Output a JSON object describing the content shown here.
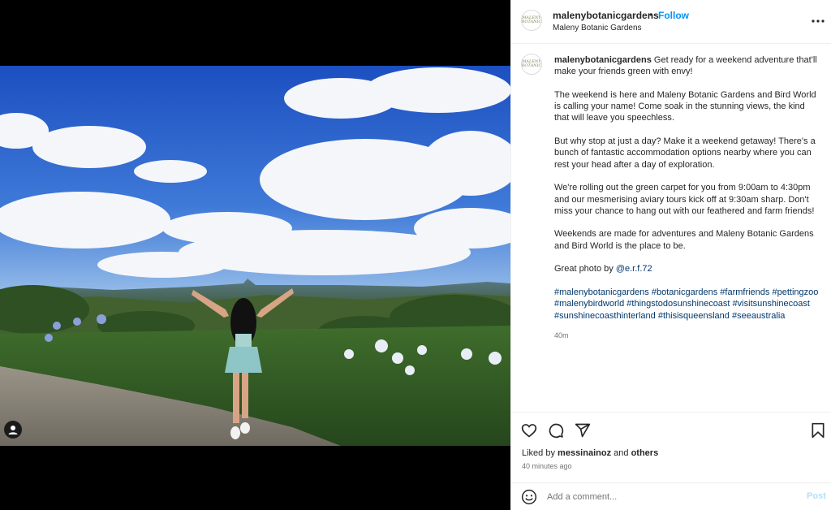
{
  "post": {
    "username": "malenybotanicgardens",
    "separator": "•",
    "follow_label": "Follow",
    "location": "Maleny Botanic Gardens",
    "avatar_text": "MALENY BOTANIC"
  },
  "caption": {
    "username": "malenybotanicgardens",
    "intro": "Get ready for a weekend adventure that'll make your friends green with envy!",
    "p1": "The weekend is here and Maleny Botanic Gardens and Bird World is calling your name! Come soak in the stunning views, the kind that will leave you speechless.",
    "p2": "But why stop at just a day? Make it a weekend getaway! There's a bunch of fantastic accommodation options nearby where you can rest your head after a day of exploration.",
    "p3": "We're rolling out the green carpet for you from 9:00am to 4:30pm and our mesmerising aviary tours kick off at 9:30am sharp. Don't miss your chance to hang out with our feathered and farm friends!",
    "p4": "Weekends are made for adventures and Maleny Botanic Gardens and Bird World is the place to be.",
    "photo_credit_prefix": "Great photo by",
    "photo_credit_handle": "@e.r.f.72",
    "hashtags": [
      "#malenybotanicgardens",
      "#botanicgardens",
      "#farmfriends",
      "#pettingzoo",
      "#malenybirdworld",
      "#thingstodosunshinecoast",
      "#visitsunshinecoast",
      "#sunshinecoasthinterland",
      "#thisisqueensland",
      "#seeaustralia"
    ],
    "time": "40m"
  },
  "likes": {
    "prefix": "Liked by",
    "user": "messinainoz",
    "conjunction": "and",
    "others": "others"
  },
  "posted_ago": "40 minutes ago",
  "comment": {
    "placeholder": "Add a comment...",
    "post_label": "Post"
  },
  "icons": {
    "more": "more-options-icon",
    "like": "heart-icon",
    "comment": "comment-icon",
    "share": "share-icon",
    "save": "bookmark-icon",
    "emoji": "emoji-icon",
    "tag": "user-tag-icon"
  },
  "colors": {
    "follow": "#0095f6",
    "link": "#00376b",
    "post_disabled": "#b2dffc",
    "muted": "#737373"
  }
}
